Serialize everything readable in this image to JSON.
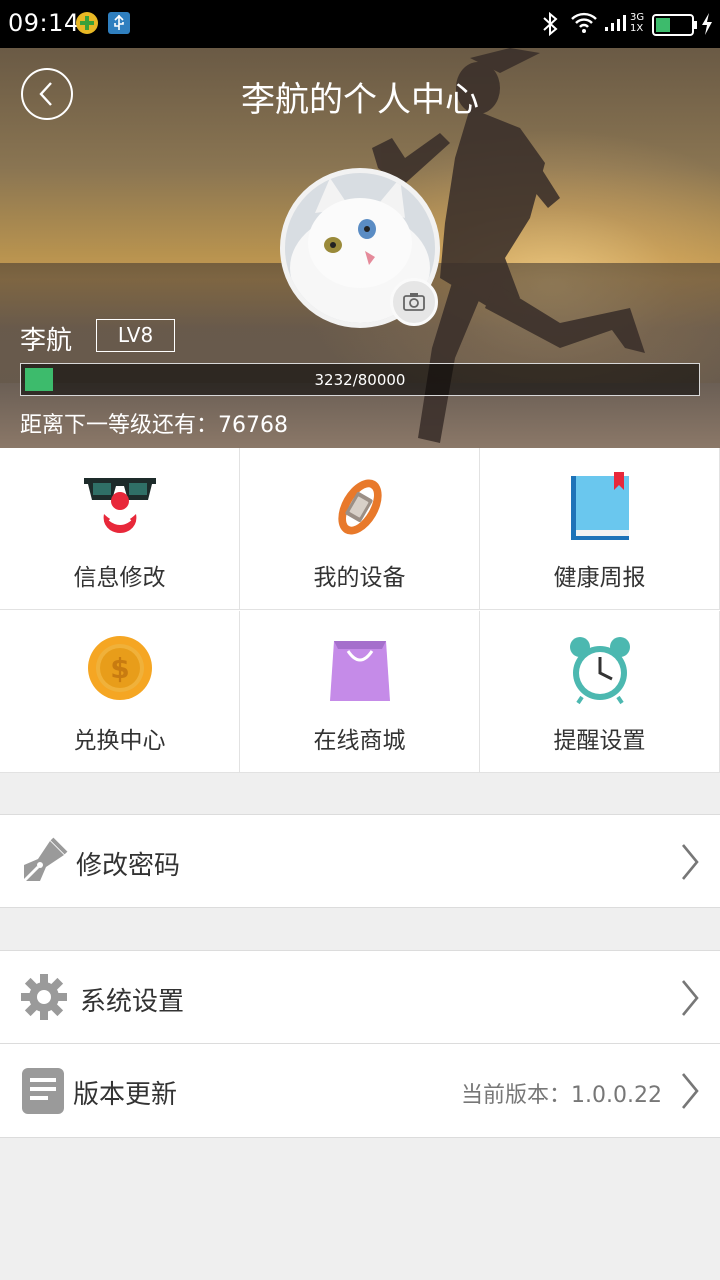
{
  "status_bar": {
    "time": "09:14",
    "network_top": "3G",
    "network_bottom": "1X",
    "icons": [
      "plus-notification-icon",
      "usb-icon",
      "bluetooth-icon",
      "wifi-icon",
      "signal-icon",
      "battery-icon",
      "charging-icon"
    ]
  },
  "header": {
    "title": "李航的个人中心",
    "back_icon": "chevron-left-icon",
    "user_name": "李航",
    "level": "LV8",
    "progress_text": "3232/80000",
    "progress_fraction": 0.0404,
    "next_level_text": "距离下一等级还有：76768"
  },
  "grid": [
    {
      "label": "信息修改",
      "icon": "clown-glasses-icon"
    },
    {
      "label": "我的设备",
      "icon": "wristband-icon"
    },
    {
      "label": "健康周报",
      "icon": "book-icon"
    },
    {
      "label": "兑换中心",
      "icon": "coin-icon"
    },
    {
      "label": "在线商城",
      "icon": "shopping-bag-icon"
    },
    {
      "label": "提醒设置",
      "icon": "alarm-clock-icon"
    }
  ],
  "menu": {
    "change_password": {
      "label": "修改密码",
      "icon": "pen-icon"
    },
    "system_settings": {
      "label": "系统设置",
      "icon": "gear-icon"
    },
    "version_update": {
      "label": "版本更新",
      "icon": "document-icon",
      "value": "当前版本：1.0.0.22"
    }
  },
  "colors": {
    "progress_fill": "#3dbb6c",
    "background": "#efefef",
    "accent_orange": "#e8792b"
  }
}
